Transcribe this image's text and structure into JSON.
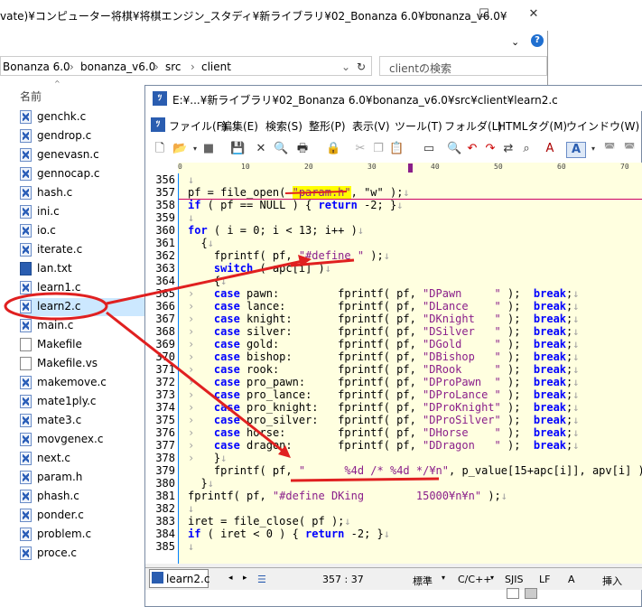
{
  "explorer": {
    "title": "vate)¥コンピューター将棋¥将棋エンジン_スタディ¥新ライブラリ¥02_Bonanza 6.0¥bonanza_v6.0¥",
    "breadcrumb": [
      "Bonanza 6.0",
      "bonanza_v6.0",
      "src",
      "client"
    ],
    "search_placeholder": "clientの検索",
    "column_header": "名前",
    "files": [
      {
        "name": "genchk.c",
        "icon": "c-source-icon"
      },
      {
        "name": "gendrop.c",
        "icon": "c-source-icon"
      },
      {
        "name": "genevasn.c",
        "icon": "c-source-icon"
      },
      {
        "name": "gennocap.c",
        "icon": "c-source-icon"
      },
      {
        "name": "hash.c",
        "icon": "c-source-icon"
      },
      {
        "name": "ini.c",
        "icon": "c-source-icon"
      },
      {
        "name": "io.c",
        "icon": "c-source-icon"
      },
      {
        "name": "iterate.c",
        "icon": "c-source-icon"
      },
      {
        "name": "lan.txt",
        "icon": "sakura-text-icon"
      },
      {
        "name": "learn1.c",
        "icon": "c-source-icon"
      },
      {
        "name": "learn2.c",
        "icon": "c-source-icon"
      },
      {
        "name": "main.c",
        "icon": "c-source-icon"
      },
      {
        "name": "Makefile",
        "icon": "file-icon"
      },
      {
        "name": "Makefile.vs",
        "icon": "file-icon"
      },
      {
        "name": "makemove.c",
        "icon": "c-source-icon"
      },
      {
        "name": "mate1ply.c",
        "icon": "c-source-icon"
      },
      {
        "name": "mate3.c",
        "icon": "c-source-icon"
      },
      {
        "name": "movgenex.c",
        "icon": "c-source-icon"
      },
      {
        "name": "next.c",
        "icon": "c-source-icon"
      },
      {
        "name": "param.h",
        "icon": "c-source-icon"
      },
      {
        "name": "phash.c",
        "icon": "c-source-icon"
      },
      {
        "name": "ponder.c",
        "icon": "c-source-icon"
      },
      {
        "name": "problem.c",
        "icon": "c-source-icon"
      },
      {
        "name": "proce.c",
        "icon": "c-source-icon"
      }
    ]
  },
  "editor": {
    "title": "E:¥...¥新ライブラリ¥02_Bonanza 6.0¥bonanza_v6.0¥src¥client¥learn2.c",
    "menu": [
      "ファイル(F)",
      "編集(E)",
      "検索(S)",
      "整形(P)",
      "表示(V)",
      "ツール(T)",
      "フォルダ(L)",
      "HTMLタグ(M)",
      "ウインドウ(W)"
    ],
    "ruler_ticks": [
      "0",
      "10",
      "20",
      "30",
      "40",
      "50",
      "60",
      "70"
    ],
    "line_numbers": [
      "356",
      "357",
      "358",
      "359",
      "360",
      "361",
      "362",
      "363",
      "364",
      "365",
      "366",
      "367",
      "368",
      "369",
      "370",
      "371",
      "372",
      "373",
      "374",
      "375",
      "376",
      "377",
      "378",
      "379",
      "380",
      "381",
      "382",
      "383",
      "384",
      "385"
    ],
    "code": {
      "l357a": "pf = file_open( ",
      "l357b": "\"param.h\"",
      "l357c": ", \"w\" );",
      "l358a": "if",
      "l358b": " ( pf == NULL ) { ",
      "l358c": "return",
      "l358d": " -2; }",
      "l360a": "for",
      "l360b": " ( i = 0; i < 13; i++ )",
      "l361": "{",
      "l362a": "fprintf( pf, ",
      "l362b": "\"#define \"",
      "l362c": " );",
      "l363a": "switch",
      "l363b": " ( apc[i] )",
      "l364": "{",
      "cases": [
        {
          "lbl": "pawn:",
          "str": "\"DPawn     \""
        },
        {
          "lbl": "lance:",
          "str": "\"DLance    \""
        },
        {
          "lbl": "knight:",
          "str": "\"DKnight   \""
        },
        {
          "lbl": "silver:",
          "str": "\"DSilver   \""
        },
        {
          "lbl": "gold:",
          "str": "\"DGold     \""
        },
        {
          "lbl": "bishop:",
          "str": "\"DBishop   \""
        },
        {
          "lbl": "rook:",
          "str": "\"DRook     \""
        },
        {
          "lbl": "pro_pawn:",
          "str": "\"DProPawn  \""
        },
        {
          "lbl": "pro_lance:",
          "str": "\"DProLance \""
        },
        {
          "lbl": "pro_knight:",
          "str": "\"DProKnight\""
        },
        {
          "lbl": "pro_silver:",
          "str": "\"DProSilver\""
        },
        {
          "lbl": "horse:",
          "str": "\"DHorse    \""
        },
        {
          "lbl": "dragon:",
          "str": "\"DDragon   \""
        }
      ],
      "case_kw": "case",
      "fprintf_pf": "fprintf( pf, ",
      "close_paren": " );",
      "break_kw": "break",
      "l378": "}",
      "l379a": "fprintf( pf, ",
      "l379b": "\"      %4d /* %4d */¥n\"",
      "l379c": ", p_value[15+apc[i]], apv[i] );",
      "l380": "}",
      "l381a": "fprintf( pf, ",
      "l381b": "\"#define DKing        15000¥n¥n\"",
      "l381c": " );",
      "l383": "iret = file_close( pf );",
      "l384a": "if",
      "l384b": " ( iret < 0 ) { ",
      "l384c": "return",
      "l384d": " -2; }"
    },
    "tab_label": "learn2.c",
    "status": {
      "position": "357 : 37",
      "indent": "標準",
      "mode": "C/C++",
      "encoding": "SJIS",
      "eol": "LF",
      "a": "A",
      "insert": "挿入"
    }
  },
  "colors": {
    "keyword": "#0000ff",
    "string": "#8a1e8a",
    "annotation": "#e02020",
    "highlight": "#ffff00"
  }
}
